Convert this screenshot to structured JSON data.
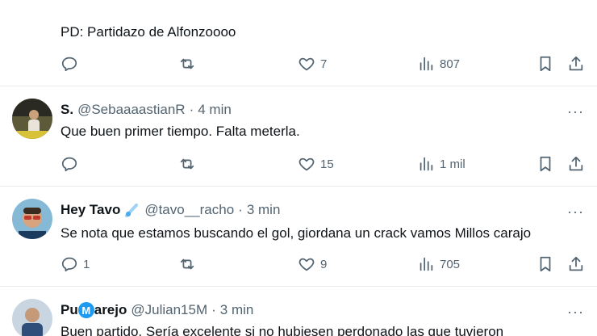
{
  "tweets": [
    {
      "text": "PD: Partidazo de Alfonzoooo",
      "replies": "",
      "retweets": "",
      "likes": "7",
      "views": "807"
    },
    {
      "name": "S.",
      "handle": "@SebaaaastianR",
      "time": "4 min",
      "text": "Que buen primer tiempo. Falta meterla.",
      "replies": "",
      "retweets": "",
      "likes": "15",
      "views": "1 mil"
    },
    {
      "name": "Hey Tavo",
      "handle": "@tavo__racho",
      "time": "3 min",
      "text": "Se nota que estamos buscando el gol, giordana un crack vamos Millos carajo",
      "replies": "1",
      "retweets": "",
      "likes": "9",
      "views": "705"
    },
    {
      "name_prefix": "Pu",
      "name_badge": "M",
      "name_suffix": "arejo",
      "handle": "@Julian15M",
      "time": "3 min",
      "text": "Buen partido. Sería excelente si no hubiesen perdonado las que tuvieron"
    }
  ],
  "separator": "·",
  "more_label": "···",
  "colors": {
    "muted": "#536471",
    "text": "#0f1419",
    "divider": "#e6ecf0",
    "badge": "#1d9bf0"
  }
}
